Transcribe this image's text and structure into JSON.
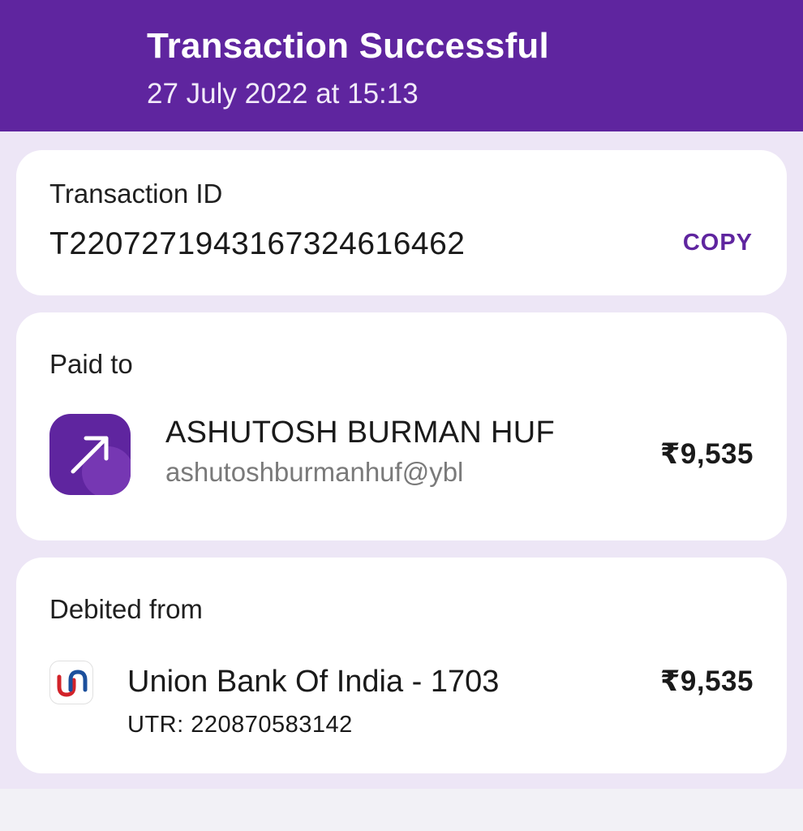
{
  "header": {
    "title": "Transaction Successful",
    "datetime": "27 July 2022 at 15:13",
    "color": "#5f259f"
  },
  "transaction": {
    "label": "Transaction ID",
    "id": "T2207271943167324616462",
    "copy_label": "COPY"
  },
  "paid_to": {
    "label": "Paid to",
    "icon": "arrow-up-right-icon",
    "name": "ASHUTOSH BURMAN HUF",
    "vpa": "ashutoshburmanhuf@ybl",
    "amount": "₹9,535"
  },
  "debited_from": {
    "label": "Debited from",
    "icon": "union-bank-logo",
    "bank": "Union Bank Of India - 1703",
    "utr": "UTR: 220870583142",
    "amount": "₹9,535"
  }
}
